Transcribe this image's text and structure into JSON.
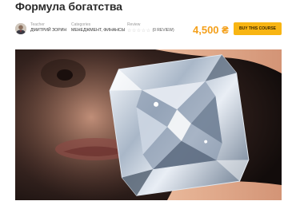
{
  "course": {
    "title": "Формула богатства",
    "teacher_label": "Teacher",
    "teacher_name": "ДМИТРИЙ ЗОРИН",
    "categories_label": "Categories",
    "categories_value": "МЕНЕДЖМЕНТ, ФИНАНСЫ",
    "review_label": "Review",
    "rating": 0,
    "rating_max": 5,
    "review_count_text": "(0 REVIEW)",
    "price": "4,500 ₴",
    "buy_label": "BUY THIS COURSE"
  },
  "colors": {
    "accent": "#f8b513",
    "price": "#f4a01b"
  },
  "icons": {
    "star": "star-icon"
  }
}
